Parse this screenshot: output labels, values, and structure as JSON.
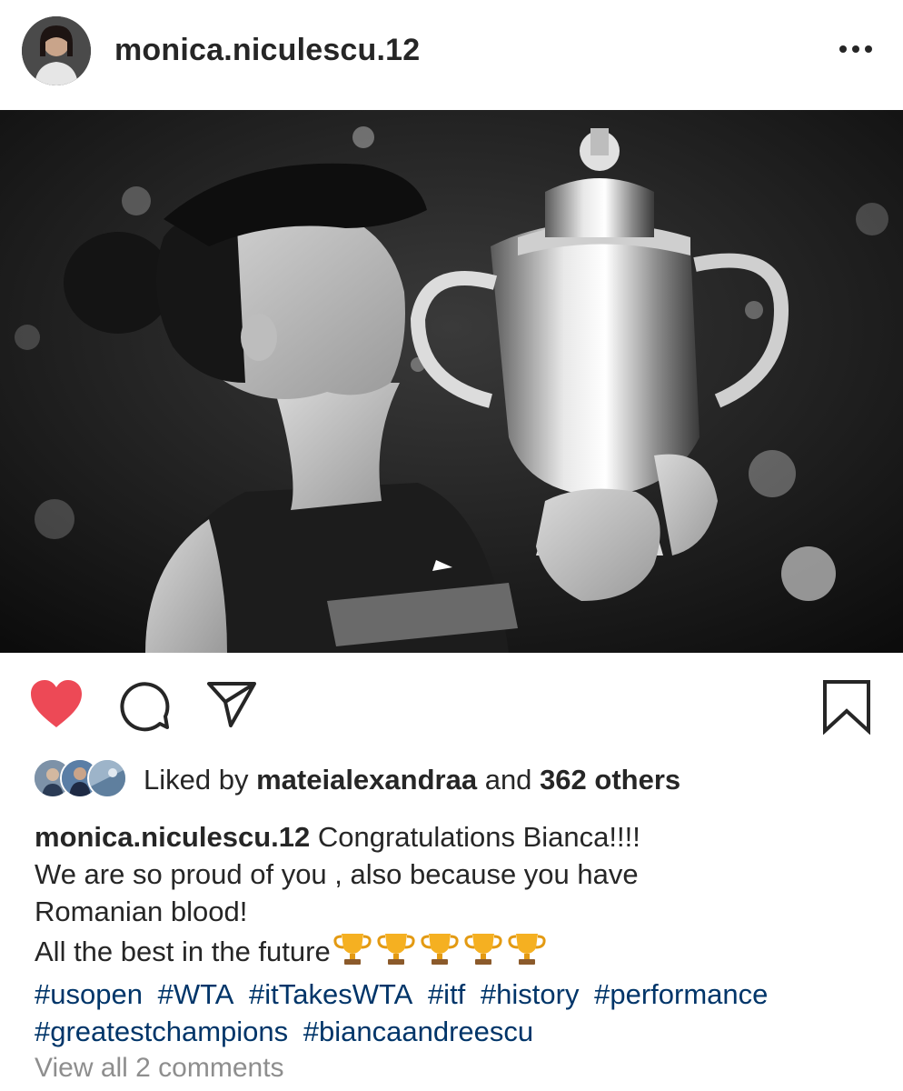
{
  "post": {
    "username": "monica.niculescu.12",
    "more_icon": "ellipsis-icon"
  },
  "actions": {
    "like_icon": "heart-filled-icon",
    "like_color": "#ED4956",
    "comment_icon": "comment-bubble-icon",
    "share_icon": "paper-plane-icon",
    "save_icon": "bookmark-icon"
  },
  "likes": {
    "prefix": "Liked by",
    "user": "mateialexandraa",
    "conj": "and",
    "count_text": "362 others"
  },
  "caption": {
    "username": "monica.niculescu.12",
    "line1": "Congratulations Bianca!!!!",
    "line2": "We are so proud of you , also because you have",
    "line3": "Romanian blood!",
    "line4": "All the best in the future",
    "trophy_count": 5,
    "hashtags": [
      "#usopen",
      "#WTA",
      "#itTakesWTA",
      "#itf",
      "#history",
      "#performance",
      "#greatestchampions",
      "#biancaandreescu"
    ]
  },
  "comments": {
    "view_all_label": "View all 2 comments"
  },
  "colors": {
    "text": "#262626",
    "hashtag": "#003569",
    "muted": "#8e8e8e"
  }
}
